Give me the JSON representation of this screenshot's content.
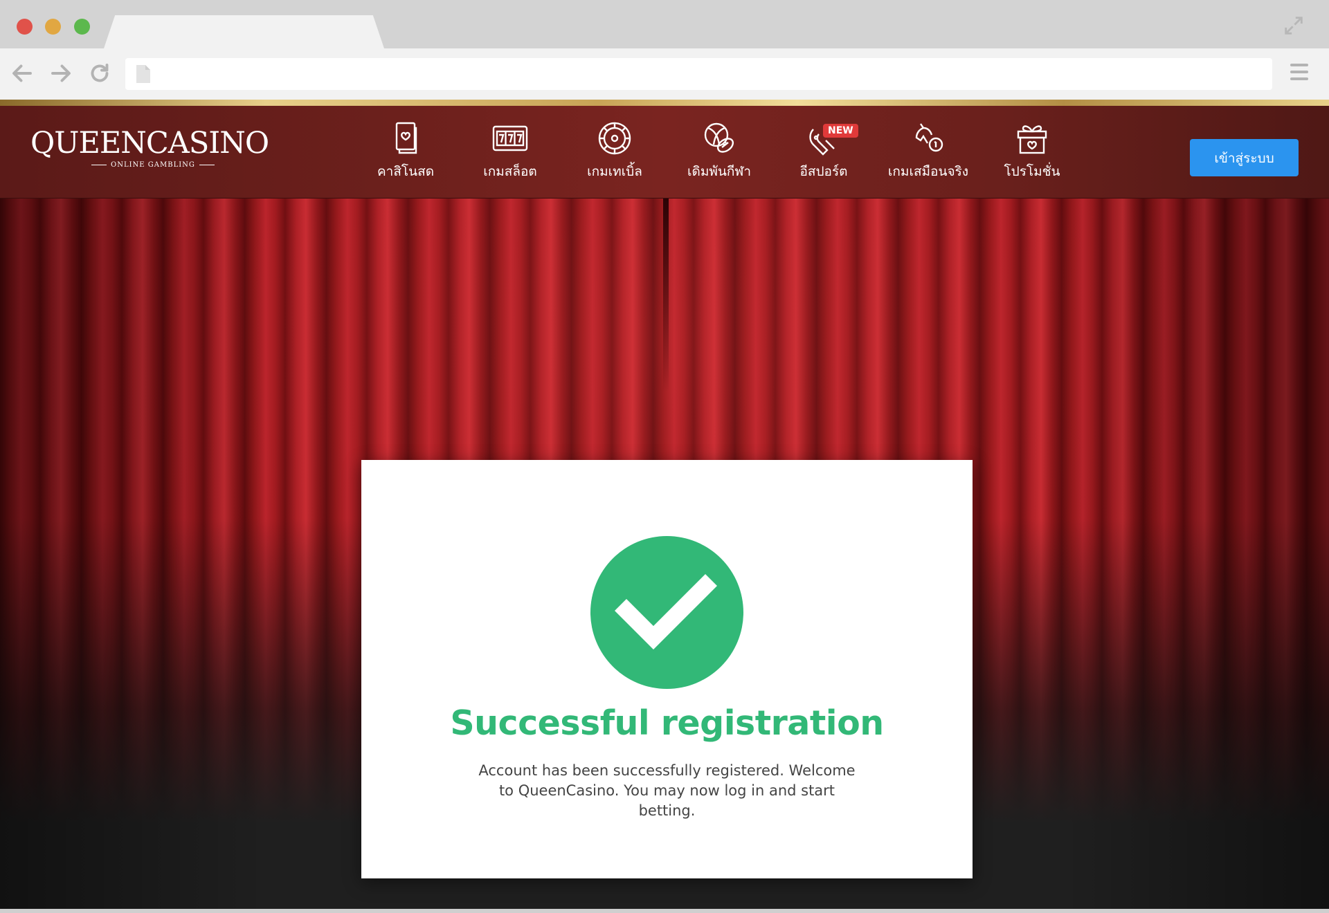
{
  "browser": {
    "address": "",
    "icons": [
      "arrow-left-icon",
      "arrow-right-icon",
      "reload-icon",
      "page-icon",
      "hamburger-menu-icon",
      "expand-icon"
    ]
  },
  "site": {
    "logo": {
      "main": "QUEENCASINO",
      "sub": "ONLINE GAMBLING"
    },
    "nav": [
      {
        "label": "คาสิโนสด",
        "icon": "card-icon"
      },
      {
        "label": "เกมสล็อต",
        "icon": "slot-machine-icon"
      },
      {
        "label": "เกมเทเบิ้ล",
        "icon": "roulette-icon"
      },
      {
        "label": "เดิมพันกีฬา",
        "icon": "sports-ball-icon"
      },
      {
        "label": "อีสปอร์ต",
        "icon": "esports-controller-icon",
        "badge": "NEW"
      },
      {
        "label": "เกมเสมือนจริง",
        "icon": "horse-racing-icon"
      },
      {
        "label": "โปรโมชั่น",
        "icon": "gift-icon"
      }
    ],
    "login_button": "เข้าสู่ระบบ",
    "colors": {
      "login": "#2b94ef",
      "success": "#32b877",
      "header": "#6c201c"
    }
  },
  "modal": {
    "icon": "check-circle-icon",
    "title": "Successful registration",
    "message": "Account has been successfully registered. Welcome to QueenCasino. You may now log in and start betting."
  }
}
